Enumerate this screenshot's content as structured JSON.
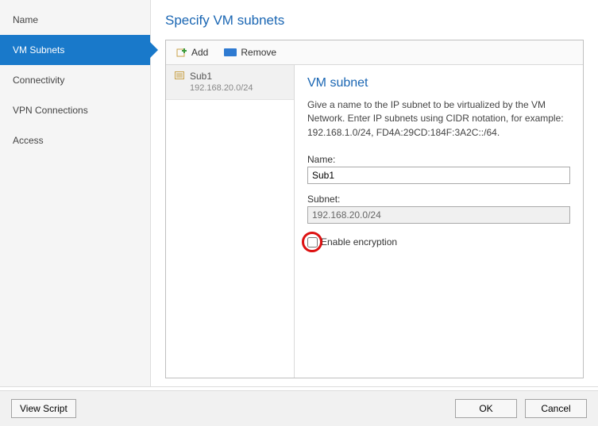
{
  "sidebar": {
    "items": [
      {
        "label": "Name"
      },
      {
        "label": "VM Subnets"
      },
      {
        "label": "Connectivity"
      },
      {
        "label": "VPN Connections"
      },
      {
        "label": "Access"
      }
    ],
    "active_index": 1
  },
  "page": {
    "title": "Specify VM subnets"
  },
  "toolbar": {
    "add_label": "Add",
    "remove_label": "Remove"
  },
  "subnet_list": [
    {
      "name": "Sub1",
      "cidr": "192.168.20.0/24"
    }
  ],
  "detail": {
    "heading": "VM subnet",
    "description": "Give a name to the IP subnet to be virtualized by the VM Network. Enter IP subnets using CIDR notation, for example: 192.168.1.0/24, FD4A:29CD:184F:3A2C::/64.",
    "name_label": "Name:",
    "name_value": "Sub1",
    "subnet_label": "Subnet:",
    "subnet_value": "192.168.20.0/24",
    "encrypt_label": "Enable encryption",
    "encrypt_checked": false
  },
  "footer": {
    "view_script": "View Script",
    "ok": "OK",
    "cancel": "Cancel"
  }
}
